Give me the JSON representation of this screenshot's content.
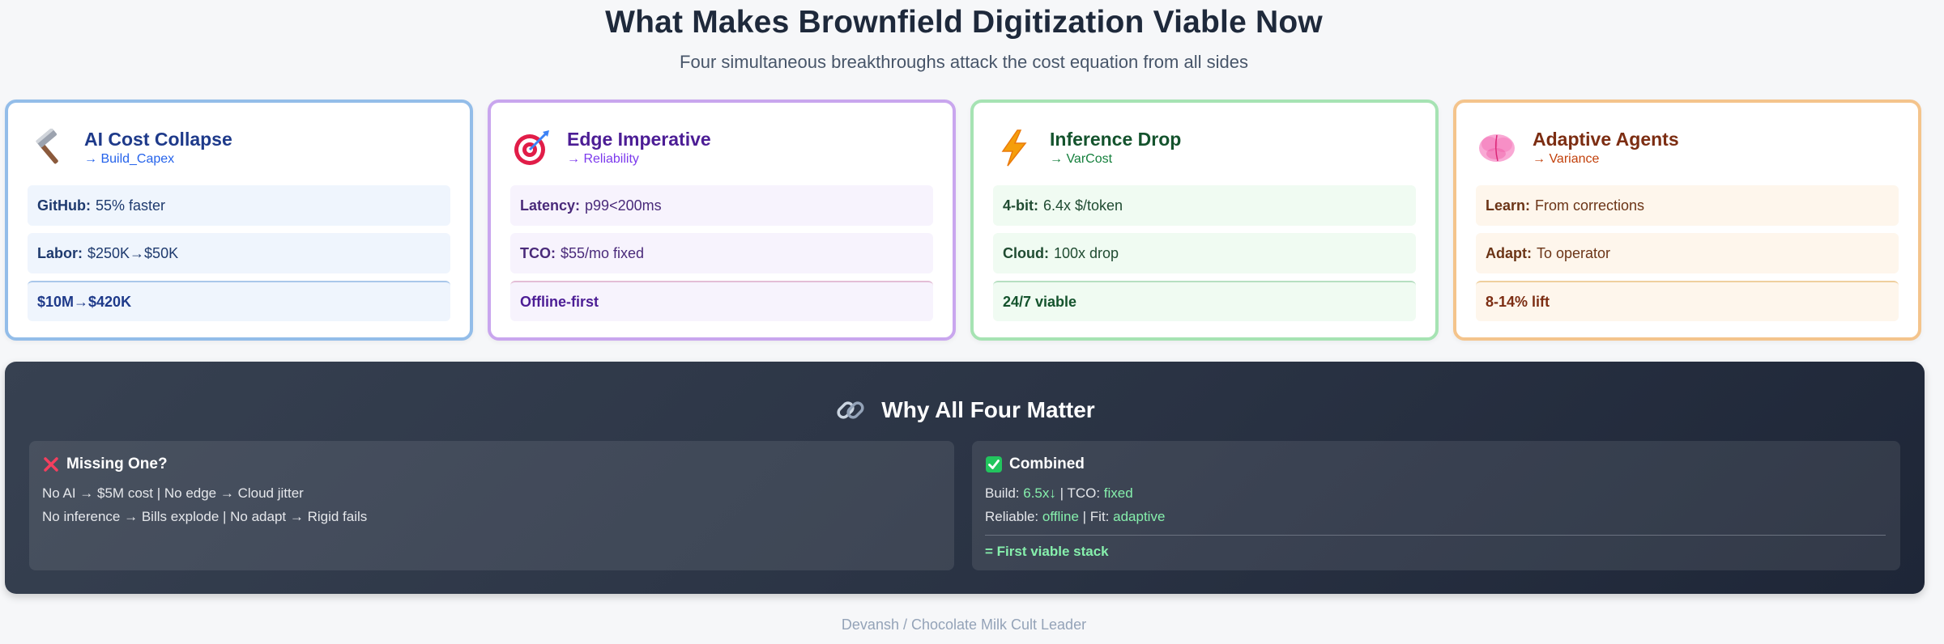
{
  "header": {
    "title": "What Makes Brownfield Digitization Viable Now",
    "subtitle": "Four simultaneous breakthroughs attack the cost equation from all sides"
  },
  "cards": [
    {
      "icon": "hammer-icon",
      "title": "AI Cost Collapse",
      "arrow": "→ Build_Capex",
      "rows": [
        {
          "label": "GitHub:",
          "value": "55% faster"
        },
        {
          "label": "Labor:",
          "value": "$250K→$50K"
        }
      ],
      "result": "$10M→$420K"
    },
    {
      "icon": "target-icon",
      "title": "Edge Imperative",
      "arrow": "→ Reliability",
      "rows": [
        {
          "label": "Latency:",
          "value": "p99<200ms"
        },
        {
          "label": "TCO:",
          "value": "$55/mo fixed"
        }
      ],
      "result": "Offline-first"
    },
    {
      "icon": "lightning-icon",
      "title": "Inference Drop",
      "arrow": "→ VarCost",
      "rows": [
        {
          "label": "4-bit:",
          "value": "6.4x $/token"
        },
        {
          "label": "Cloud:",
          "value": "100x drop"
        }
      ],
      "result": "24/7 viable"
    },
    {
      "icon": "brain-icon",
      "title": "Adaptive Agents",
      "arrow": "→ Variance",
      "rows": [
        {
          "label": "Learn:",
          "value": "From corrections"
        },
        {
          "label": "Adapt:",
          "value": "To operator"
        }
      ],
      "result": "8-14% lift"
    }
  ],
  "panel": {
    "icon": "link-icon",
    "title": "Why All Four Matter",
    "missing": {
      "icon": "cross-mark-icon",
      "title": "Missing One?",
      "line1": "No AI → $5M cost | No edge → Cloud jitter",
      "line2": "No inference → Bills explode | No adapt → Rigid fails"
    },
    "combined": {
      "icon": "check-mark-icon",
      "title": "Combined",
      "build_label": "Build: ",
      "build_value": "6.5x↓",
      "tco_label": " | TCO: ",
      "tco_value": "fixed",
      "reliable_label": "Reliable: ",
      "reliable_value": "offline",
      "fit_label": " | Fit: ",
      "fit_value": "adaptive",
      "conclusion": "= First viable stack"
    },
    "colors": {
      "highlight": "#86efac",
      "background": "#2a3344"
    }
  },
  "footer": "Devansh / Chocolate Milk Cult Leader"
}
